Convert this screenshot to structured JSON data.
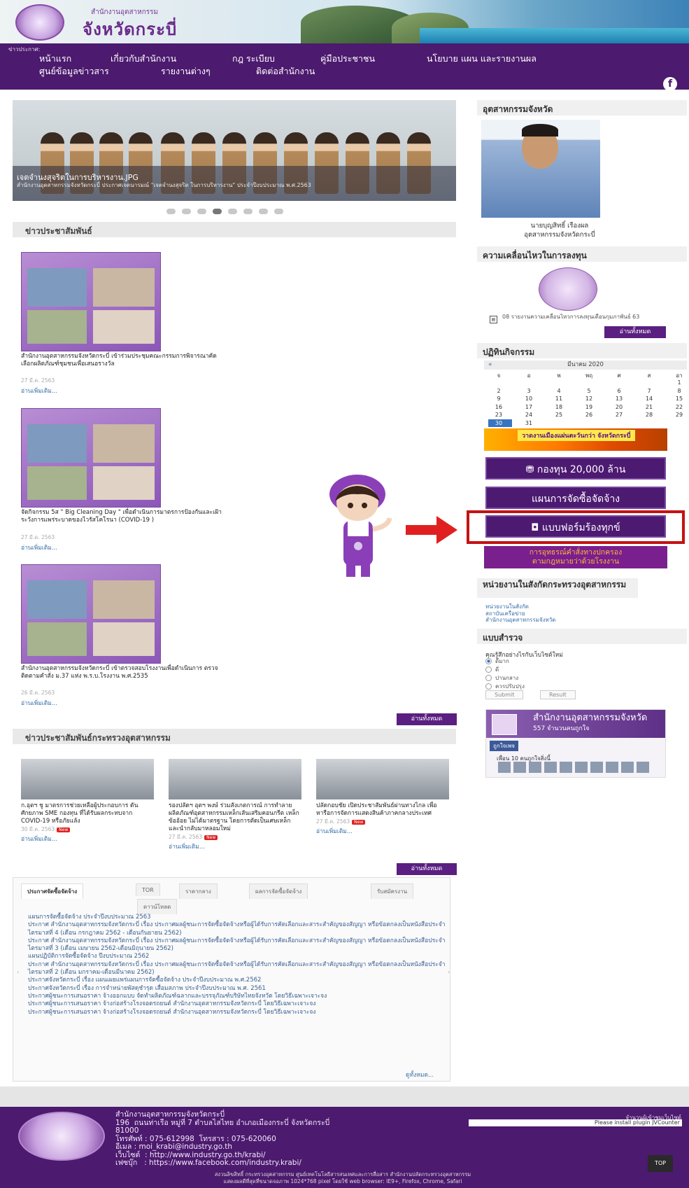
{
  "header": {
    "site_title": "จังหวัดกระบี่",
    "site_sub": "สำนักงานอุตสาหกรรม",
    "nav_label": "ข่าวประกาศ:",
    "nav_row1": [
      "หน้าแรก",
      "เกี่ยวกับสำนักงาน",
      "กฎ ระเบียบ",
      "คู่มือประชาชน",
      "นโยบาย แผน และรายงานผล"
    ],
    "nav_row2": [
      "ศูนย์ข้อมูลข่าวสาร",
      "รายงานต่างๆ",
      "ติดต่อสำนักงาน"
    ],
    "fb_icon": "f"
  },
  "slider": {
    "title": "เจตจำนงสุจริตในการบริหารงาน.JPG",
    "desc": "สำนักงานอุตสาหกรรมจังหวัดกระบี่ ประกาศเจตนารมณ์ \"เจตจำนงสุจริต ในการบริหารงาน\" ประจำปีงบประมาณ พ.ศ.2563",
    "dot_count": 8,
    "active_dot": 3
  },
  "pr_news": {
    "heading": "ข่าวประชาสัมพันธ์",
    "items": [
      {
        "title": "สำนักงานอุตสาหกรรมจังหวัดกระบี่ เข้าร่วมประชุมคณะกรรมการพิจารณาคัดเลือกผลิตภัณฑ์ชุมชนเพื่อเสนอรางวัล",
        "date": "27 มี.ค. 2563",
        "more": "อ่านเพิ่มเติม..."
      },
      {
        "title": "จัดกิจกรรม 5ส \" Big Cleaning Day \" เพื่อดำเนินการมาตรการป้องกันและเฝ้าระวังการแพร่ระบาดของไวรัสโคโรนา (COVID-19 )",
        "date": "27 มี.ค. 2563",
        "more": "อ่านเพิ่มเติม..."
      },
      {
        "title": "สำนักงานอุตสาหกรรมจังหวัดกระบี่ เข้าตรวจสอบโรงงานเพื่อดำเนินการ ตรวจติดตามคำสั่ง ม.37 แห่ง พ.ร.บ.โรงงาน พ.ศ.2535",
        "date": "26 มี.ค. 2563",
        "more": "อ่านเพิ่มเติม..."
      }
    ],
    "all_button": "อ่านทั้งหมด"
  },
  "ministry_news": {
    "heading": "ข่าวประชาสัมพันธ์กระทรวงอุตสาหกรรม",
    "items": [
      {
        "title": "ก.อุตฯ ชู มาตรการช่วยเหลือผู้ประกอบการ ดัน ศักยภาพ SME กองทุน ที่ได้รับผลกระทบจาก COVID-19 หรือภัยแล้ง",
        "date": "30 มี.ค. 2563",
        "badge": "New",
        "more": "อ่านเพิ่มเติม..."
      },
      {
        "title": "รองปลัดฯ อุตฯ พงษ์ ร่วมสังเกตการณ์ การทำลายผลิตภัณฑ์อุตสาหกรรมเหล็กเส้นเสริมคอนกรีต เหล็กข้ออ้อย ไม่ได้มาตรฐาน โดยการตัดเป็นเศษเหล็ก และนำกลับมาหลอมใหม่",
        "date": "27 มี.ค. 2563",
        "badge": "New",
        "more": "อ่านเพิ่มเติม..."
      },
      {
        "title": "ปลัดกอบชัย เปิดประชาสัมพันธ์ผ่านทางไกล เพื่อหารือการจัดการแสดงสินค้าภาคกลางประเทศ",
        "date": "27 มี.ค. 2563",
        "badge": "New",
        "more": "อ่านเพิ่มเติม..."
      }
    ],
    "all_button": "อ่านทั้งหมด"
  },
  "tabs": {
    "labels": [
      "ประกาศจัดซื้อจัดจ้าง",
      "TOR",
      "ราคากลาง",
      "ผลการจัดซื้อจัดจ้าง",
      "รับสมัครงาน",
      "ดาวน์โหลด"
    ],
    "items": [
      "แผนการจัดซื้อจัดจ้าง ประจำปีงบประมาณ 2563",
      "ประกาศ สำนักงานอุตสาหกรรมจังหวัดกระบี่ เรื่อง ประกาศผลผู้ชนะการจัดซื้อจัดจ้างหรือผู้ได้รับการคัดเลือกและสาระสำคัญของสัญญา หรือข้อตกลงเป็นหนังสือประจำ ไตรมาสที่ 4 (เดือน กรกฎาคม 2562 - เดือนกันยายน 2562)",
      "ประกาศ สำนักงานอุตสาหกรรมจังหวัดกระบี่ เรื่อง ประกาศผลผู้ชนะการจัดซื้อจัดจ้างหรือผู้ได้รับการคัดเลือกและสาระสำคัญของสัญญา หรือข้อตกลงเป็นหนังสือประจำ ไตรมาสที่ 3 (เดือน เมษายน 2562-เดือนมิถุนายน 2562)",
      "แผนปฏิบัติการจัดซื้อจัดจ้าง ปีงบประมาณ 2562",
      "ประกาศ สำนักงานอุตสาหกรรมจังหวัดกระบี่ เรื่อง ประกาศผลผู้ชนะการจัดซื้อจัดจ้างหรือผู้ได้รับการคัดเลือกและสาระสำคัญของสัญญา หรือข้อตกลงเป็นหนังสือประจำ ไตรมาสที่ 2 (เดือน มกราคม-เดือนมีนาคม 2562)",
      "ประกาศจังหวัดกระบี่ เรื่อง แผนเผยแพร่แผนการจัดซื้อจัดจ้าง ประจำปีงบประมาณ พ.ศ.2562",
      "ประกาศจังหวัดกระบี่ เรื่อง การจำหน่ายพัสดุชำรุด เสื่อมสภาพ ประจำปีงบประมาณ พ.ศ. 2561",
      "ประกาศผู้ชนะการเสนอราคา จ้างออกแบบ จัดทำผลิตภัณฑ์ฉลากและบรรจุภัณฑ์บริษัทไทยจังหวัด โดยวิธีเฉพาะเจาะจง",
      "ประกาศผู้ชนะการเสนอราคา จ้างก่อสร้างโรงจอดรถยนต์ สำนักงานอุตสาหกรรมจังหวัดกระบี่ โดยวิธีเฉพาะเจาะจง",
      "ประกาศผู้ชนะการเสนอราคา จ้างก่อสร้างโรงจอดรถยนต์ สำนักงานอุตสาหกรรมจังหวัดกระบี่ โดยวิธีเฉพาะเจาะจง"
    ],
    "view_all": "ดูทั้งหมด..."
  },
  "sidebar": {
    "governor_heading": "อุตสาหกรรมจังหวัด",
    "governor_name": "นายบุญสิทธิ์ เรืองผล",
    "governor_title": "อุตสาหกรรมจังหวัดกระบี่",
    "invest_heading": "ความเคลื่อนไหวในการลงทุน",
    "invest_item": "08 รายงานความเคลื่อนไหวการลงทุนเดือนกุมภาพันธ์ 63",
    "invest_all": "อ่านทั้งหมด",
    "activity_heading": "ปฏิทินกิจกรรม",
    "calendar": {
      "prev": "«",
      "month": "มีนาคม 2020",
      "weekdays": [
        "จ",
        "อ",
        "พ",
        "พฤ",
        "ศ",
        "ส",
        "อา"
      ],
      "rows": [
        [
          "",
          "",
          "",
          "",
          "",
          "",
          "1"
        ],
        [
          "2",
          "3",
          "4",
          "5",
          "6",
          "7",
          "8"
        ],
        [
          "9",
          "10",
          "11",
          "12",
          "13",
          "14",
          "15"
        ],
        [
          "16",
          "17",
          "18",
          "19",
          "20",
          "21",
          "22"
        ],
        [
          "23",
          "24",
          "25",
          "26",
          "27",
          "28",
          "29"
        ],
        [
          "30",
          "31",
          "",
          "",
          "",
          "",
          ""
        ]
      ]
    },
    "fruit_banner": "วาดงานเมืองแผ่นตะวันกว่า",
    "fruit_sub": "จังหวัดกระบี่",
    "fund_button": "กองทุน 20,000 ล้าน",
    "procurement_button": "แผนการจัดซื้อจัดจ้าง",
    "complaint_button": "แบบฟอร์มร้องทุกข์",
    "law_line1": "การอุทธรณ์คำสั่งทางปกครอง",
    "law_line2": "ตามกฎหมายว่าด้วยโรงงาน",
    "dept_heading": "หน่วยงานในสังกัดกระทรวงอุตสาหกรรม",
    "dept_links": [
      "หน่วยงานในสังกัด",
      "สถาบันเครือข่าย",
      "สำนักงานอุตสาหกรรมจังหวัด"
    ],
    "poll_heading": "แบบสำรวจ",
    "poll_question": "คุณรู้สึกอย่างไรกับเว็บไซต์ใหม่",
    "poll_options": [
      "ดีมาก",
      "ดี",
      "ปานกลาง",
      "ควรปรับปรุง"
    ],
    "poll_submit": "Submit",
    "poll_result": "Result",
    "fb_page_name": "สำนักงานอุตสาหกรรมจังหวัด",
    "fb_likes": "557 จำนวนคนถูกใจ",
    "fb_like": "ถูกใจเพจ",
    "fb_friends": "เพื่อน 10 คนถูกใจสิ่งนี้"
  },
  "footer": {
    "info": "สำนักงานอุตสาหกรรมจังหวัดกระบี่\n196  ถนนท่าเรือ หมู่ที่ 7 ตำบลไสไทย อำเภอเมืองกระบี่ จังหวัดกระบี่\n81000\nโทรศัพท์ : 075-612998  โทรสาร : 075-620060\nอีเมล : moi_krabi@industry.go.th\nเว็บไซต์  : http://www.industry.go.th/krabi/\nเฟซบุ๊ก   : https://www.facebook.com/industry.krabi/",
    "counter_label": "จำนวนผู้เข้าชมเว็บไซต์",
    "counter_text": "Please install plugin JVCounter",
    "top_button": "TOP",
    "copy1": "สงวนลิขสิทธิ์ กระทรวงอุตสาหกรรม ศูนย์เทคโนโลยีสารสนเทศและการสื่อสาร สำนักงานปลัดกระทรวงอุตสาหกรรม",
    "copy2": "แสดงผลดีที่สุดที่ขนาดจอภาพ 1024*768 pixel โดยใช้ web browser: IE9+, Firefox, Chrome, Safari"
  },
  "colors": {
    "brand": "#4c1a6e",
    "accent": "#c51212",
    "link": "#3a6fa8"
  }
}
